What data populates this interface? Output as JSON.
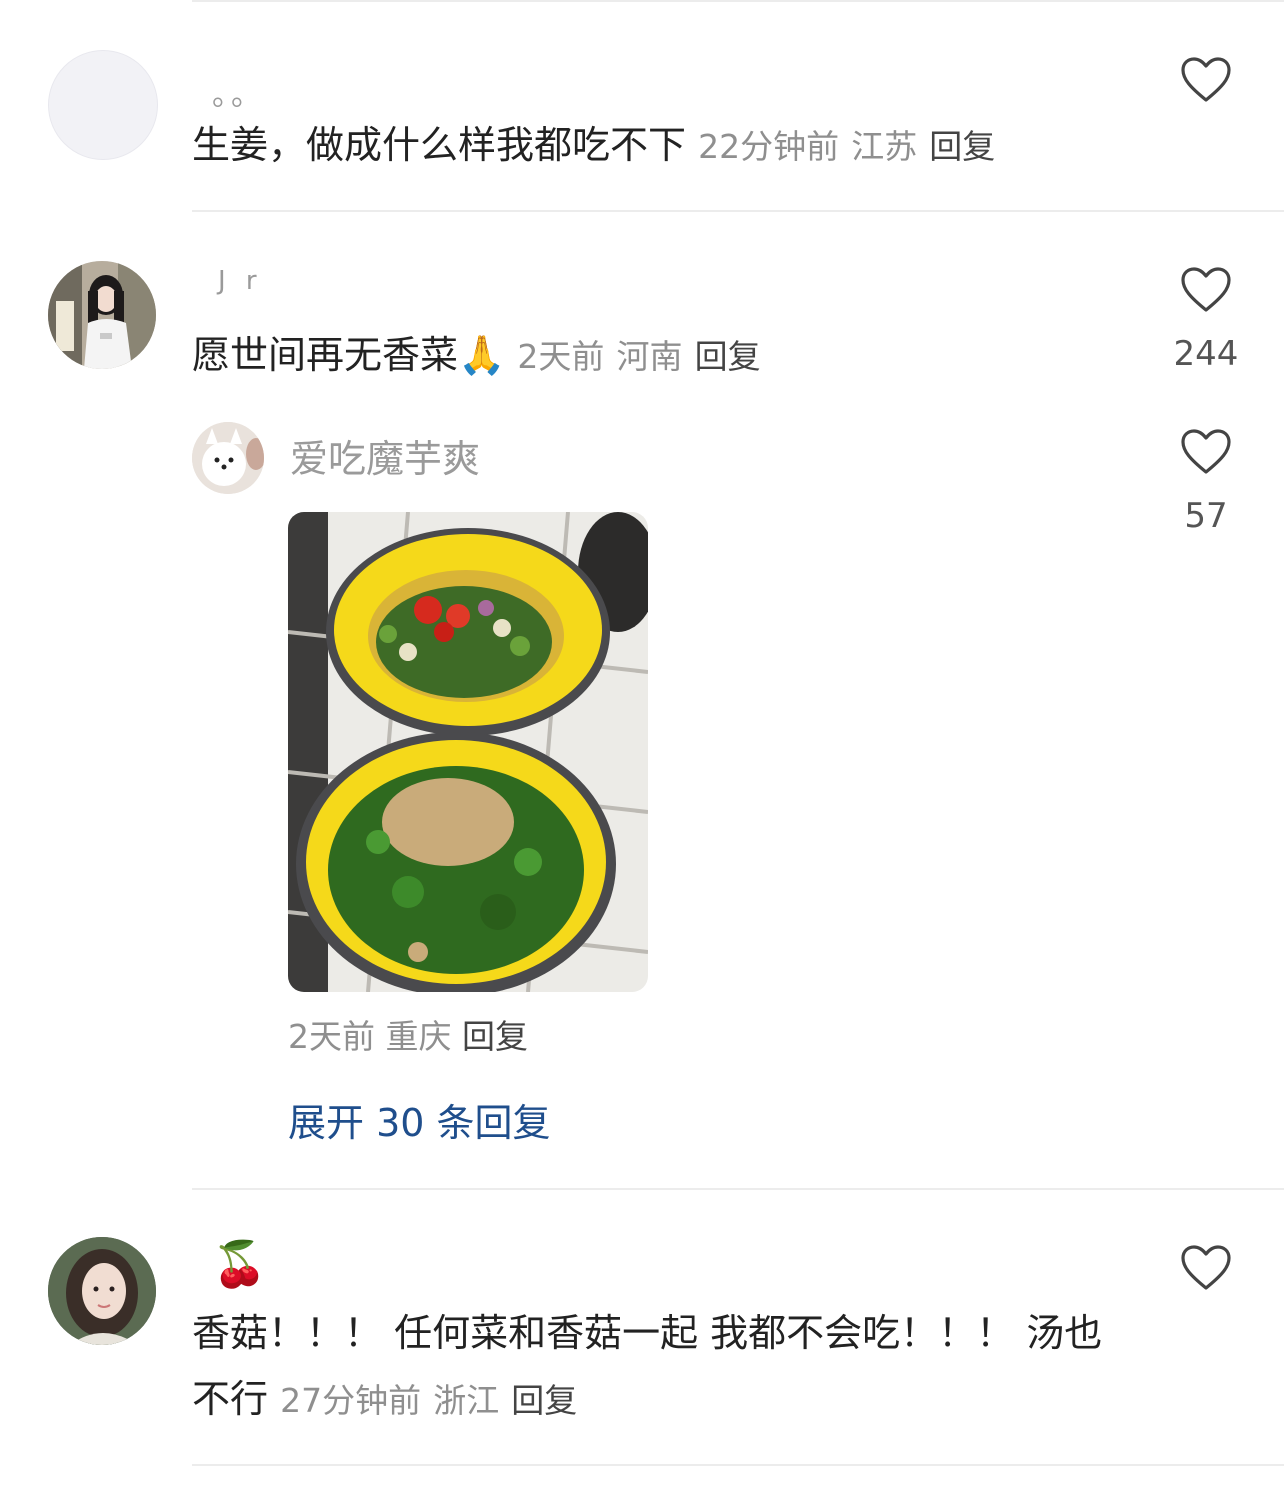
{
  "comments": [
    {
      "username": "。。",
      "text": "生姜，做成什么样我都吃不下",
      "time": "22分钟前",
      "location": "江苏",
      "reply_label": "回复",
      "like_count": "",
      "avatar_icon": "blank-avatar"
    },
    {
      "username": "J r",
      "text": "愿世间再无香菜🙏",
      "time": "2天前",
      "location": "河南",
      "reply_label": "回复",
      "like_count": "244",
      "avatar_icon": "girl-photo-avatar",
      "sub_reply": {
        "username": "爱吃魔芋爽",
        "time": "2天前",
        "location": "重庆",
        "reply_label": "回复",
        "like_count": "57",
        "image_icon": "bowls-of-chopped-herbs-photo"
      },
      "expand_label": "展开 30 条回复"
    },
    {
      "username": "🍒",
      "text_line1": "香菇！！！ 任何菜和香菇一起 我都不会吃！！！ 汤也",
      "text_line2": "不行",
      "time": "27分钟前",
      "location": "浙江",
      "reply_label": "回复",
      "like_count": "",
      "avatar_icon": "girl-portrait-avatar"
    }
  ],
  "colors": {
    "accent_link": "#1f4e8c",
    "meta_grey": "#8f8f8f",
    "text_dark": "#222222",
    "divider": "#ececec"
  }
}
